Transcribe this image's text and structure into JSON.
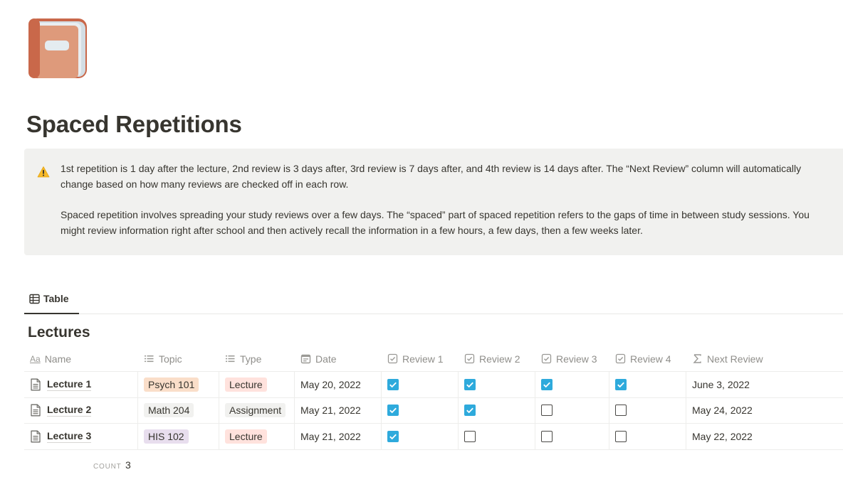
{
  "page": {
    "icon": "notebook-icon",
    "title": "Spaced Repetitions"
  },
  "callout": {
    "icon": "warning-icon",
    "paragraphs": [
      "1st repetition is 1 day after the lecture, 2nd review is 3 days after, 3rd review is 7 days after, and 4th review is 14 days after. The “Next Review” column will automatically change based on how many reviews are checked off in each row.",
      "Spaced repetition involves spreading your study reviews over a few days. The “spaced” part of spaced repetition refers to the gaps of time in between study sessions. You might review information right after school and then actively recall the information in a few hours, a few days, then a few weeks later."
    ]
  },
  "views": {
    "tabs": [
      {
        "label": "Table",
        "icon": "table-icon",
        "active": true
      }
    ]
  },
  "database": {
    "title": "Lectures",
    "columns": [
      {
        "label": "Name",
        "icon": "text-aa-icon",
        "prefix": "Aa"
      },
      {
        "label": "Topic",
        "icon": "list-icon"
      },
      {
        "label": "Type",
        "icon": "list-icon"
      },
      {
        "label": "Date",
        "icon": "calendar-icon"
      },
      {
        "label": "Review 1",
        "icon": "checkbox-icon"
      },
      {
        "label": "Review 2",
        "icon": "checkbox-icon"
      },
      {
        "label": "Review 3",
        "icon": "checkbox-icon"
      },
      {
        "label": "Review 4",
        "icon": "checkbox-icon"
      },
      {
        "label": "Next Review",
        "icon": "sigma-icon"
      }
    ],
    "rows": [
      {
        "name": "Lecture 1",
        "topic": {
          "label": "Psych 101",
          "color": "#fadec9"
        },
        "type": {
          "label": "Lecture",
          "color": "#ffe2dd"
        },
        "date": "May 20, 2022",
        "reviews": [
          true,
          true,
          true,
          true
        ],
        "next_review": "June 3, 2022"
      },
      {
        "name": "Lecture 2",
        "topic": {
          "label": "Math 204",
          "color": "#f1f1ef"
        },
        "type": {
          "label": "Assignment",
          "color": "#f1f1ef"
        },
        "date": "May 21, 2022",
        "reviews": [
          true,
          true,
          false,
          false
        ],
        "next_review": "May 24, 2022"
      },
      {
        "name": "Lecture 3",
        "topic": {
          "label": "HIS 102",
          "color": "#e8deee"
        },
        "type": {
          "label": "Lecture",
          "color": "#ffe2dd"
        },
        "date": "May 21, 2022",
        "reviews": [
          true,
          false,
          false,
          false
        ],
        "next_review": "May 22, 2022"
      }
    ],
    "footer": {
      "count_label": "COUNT",
      "count_value": "3"
    }
  },
  "colors": {
    "checkbox_checked": "#2eaadc",
    "callout_bg": "#f1f1ef",
    "text": "#37352f",
    "muted": "#8f8e8a"
  }
}
